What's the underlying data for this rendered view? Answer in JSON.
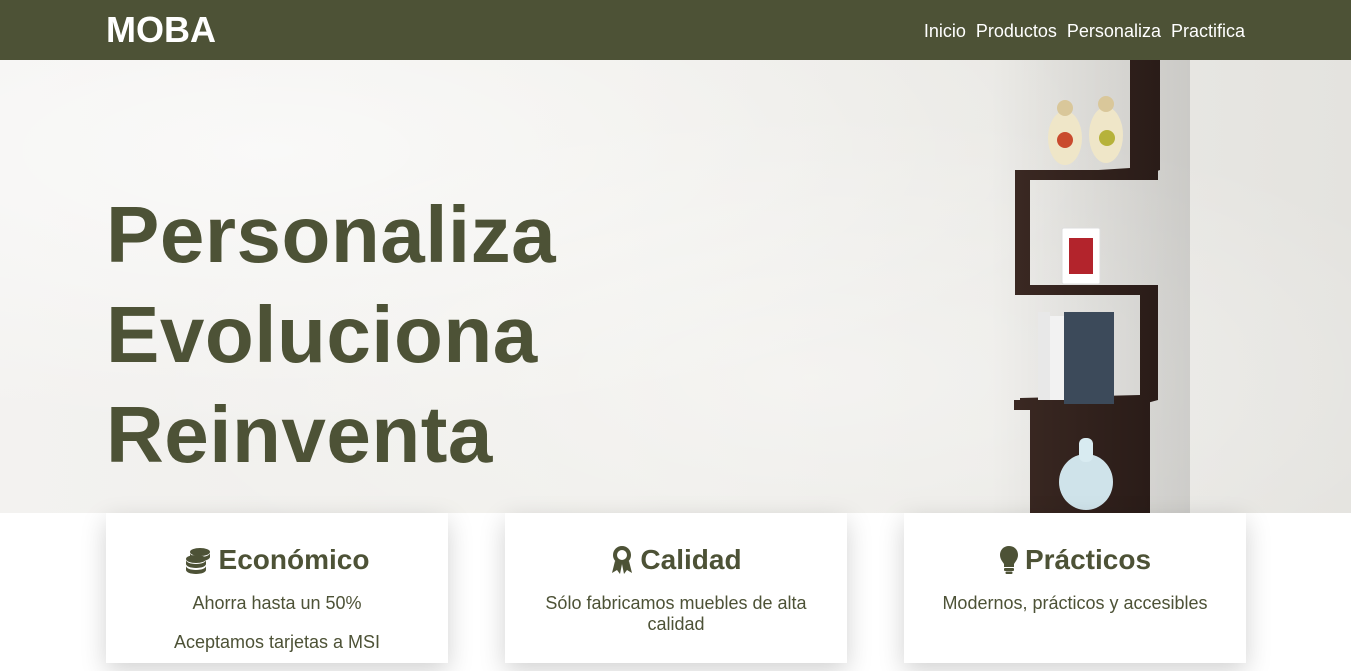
{
  "header": {
    "logo": "MOBA",
    "nav": [
      "Inicio",
      "Productos",
      "Personaliza",
      "Practifica"
    ]
  },
  "hero": {
    "lines": [
      "Personaliza",
      "Evoluciona",
      "Reinventa"
    ]
  },
  "features": [
    {
      "icon": "coins-icon",
      "title": "Económico",
      "texts": [
        "Ahorra hasta un 50%",
        "Aceptamos tarjetas a MSI"
      ]
    },
    {
      "icon": "award-icon",
      "title": "Calidad",
      "texts": [
        "Sólo fabricamos muebles de alta calidad"
      ]
    },
    {
      "icon": "lightbulb-icon",
      "title": "Prácticos",
      "texts": [
        "Modernos, prácticos y accesibles"
      ]
    }
  ],
  "colors": {
    "brand": "#4d5236",
    "header_text": "#ffffff"
  }
}
